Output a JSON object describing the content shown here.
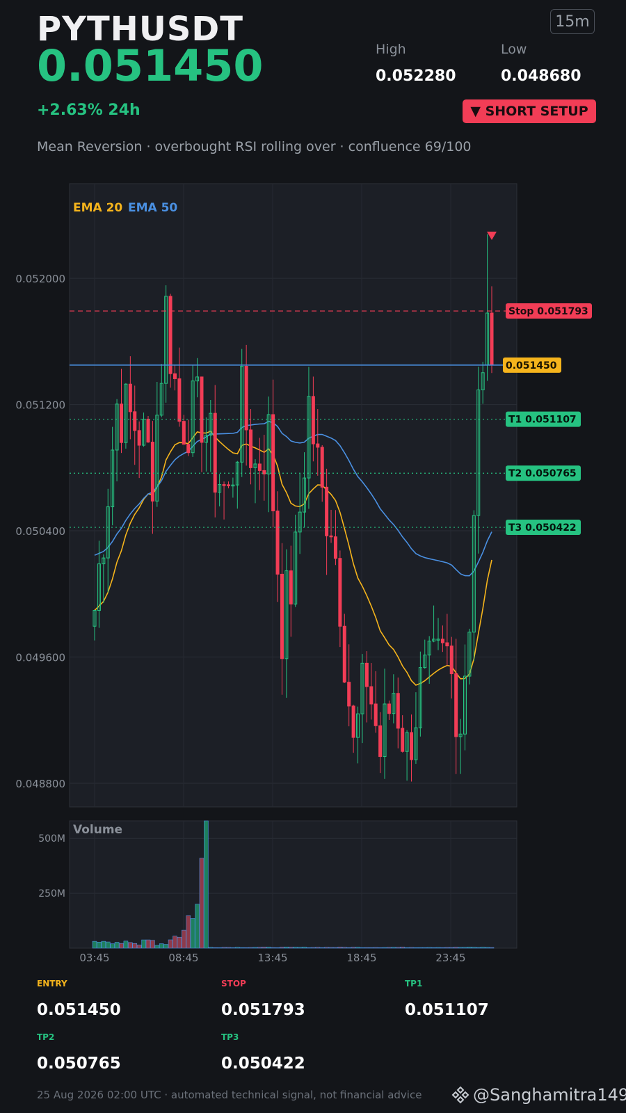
{
  "header": {
    "symbol": "PYTHUSDT",
    "price": "0.051450",
    "change": "+2.63%  24h",
    "timeframe": "15m",
    "high_label": "High",
    "high": "0.052280",
    "low_label": "Low",
    "low": "0.048680",
    "setup_badge": "▼ SHORT SETUP",
    "subtitle": "Mean Reversion · overbought RSI rolling over · confluence 69/100"
  },
  "colors": {
    "up": "#26c281",
    "down": "#f23d56",
    "ema20": "#f5b41c",
    "ema50": "#4a90e2",
    "entry": "#f5b41c"
  },
  "chart_data": {
    "type": "candlestick",
    "ylim": [
      0.04865,
      0.0526
    ],
    "yticks": [
      "0.052000",
      "0.051200",
      "0.050400",
      "0.049600",
      "0.048800"
    ],
    "xticks": [
      "03:45",
      "08:45",
      "13:45",
      "18:45",
      "23:45"
    ],
    "legend": [
      "EMA 20",
      "EMA 50"
    ],
    "levels": {
      "stop": {
        "label": "Stop 0.051793",
        "value": 0.051793
      },
      "entry": {
        "label": "0.051450",
        "value": 0.05145
      },
      "t1": {
        "label": "T1 0.051107",
        "value": 0.051107
      },
      "t2": {
        "label": "T2 0.050765",
        "value": 0.050765
      },
      "t3": {
        "label": "T3 0.050422",
        "value": 0.050422
      }
    },
    "volume_title": "Volume",
    "volume_ticks": [
      "500M",
      "250M"
    ],
    "volume_ylim": [
      0,
      580
    ]
  },
  "levels_panel": [
    {
      "label": "ENTRY",
      "value": "0.051450",
      "color": "#f5b41c"
    },
    {
      "label": "STOP",
      "value": "0.051793",
      "color": "#f23d56"
    },
    {
      "label": "TP1",
      "value": "0.051107",
      "color": "#26c281"
    },
    {
      "label": "TP2",
      "value": "0.050765",
      "color": "#26c281"
    },
    {
      "label": "TP3",
      "value": "0.050422",
      "color": "#26c281"
    }
  ],
  "footer": {
    "note": "25 Aug 2026 02:00 UTC  ·  automated technical signal, not financial advice",
    "brand": "@Sanghamitra149",
    "brand_icon": "binance-icon"
  }
}
